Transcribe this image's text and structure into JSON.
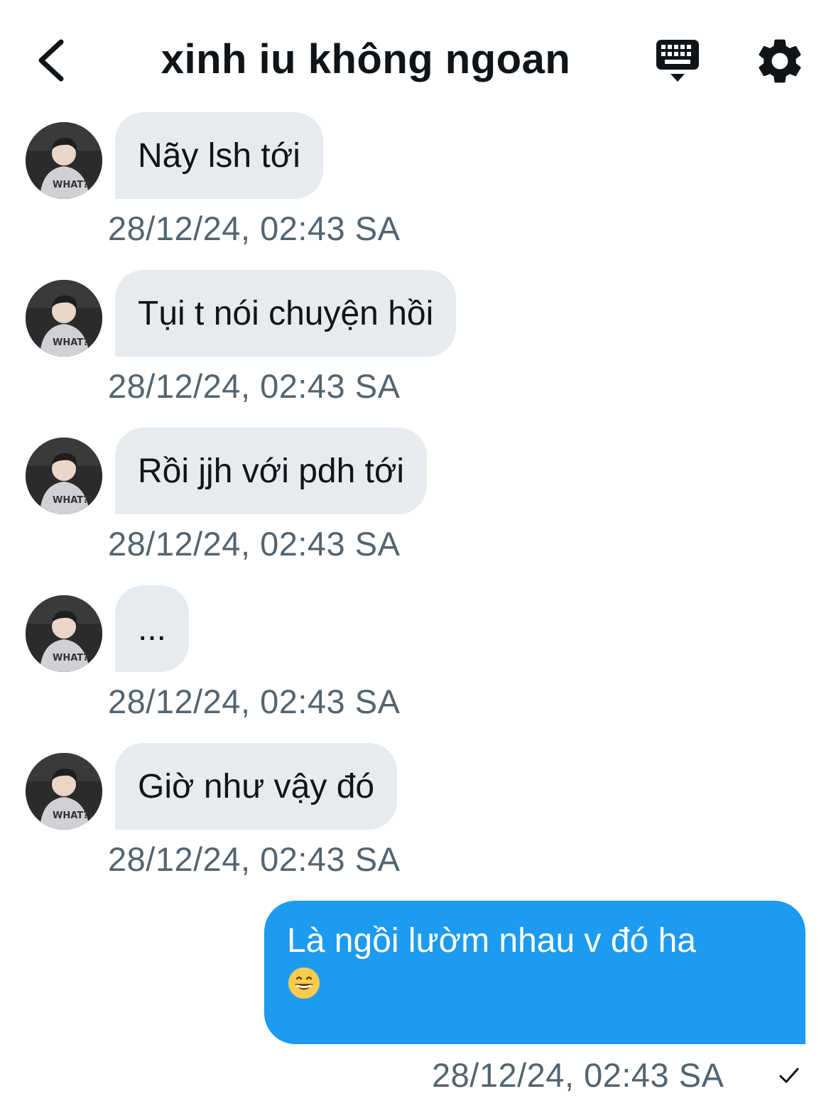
{
  "header": {
    "title": "xinh iu không ngoan",
    "back_icon": "chevron-left-icon",
    "keyboard_icon": "keyboard-icon",
    "settings_icon": "gear-icon"
  },
  "messages": [
    {
      "text": "Nãy lsh tới",
      "time": "28/12/24, 02:43 SA",
      "direction": "in"
    },
    {
      "text": "Tụi t nói chuyện hồi",
      "time": "28/12/24, 02:43 SA",
      "direction": "in"
    },
    {
      "text": "Rồi jjh với pdh tới",
      "time": "28/12/24, 02:43 SA",
      "direction": "in"
    },
    {
      "text": "...",
      "time": "28/12/24, 02:43 SA",
      "direction": "in"
    },
    {
      "text": "Giờ như vậy đó",
      "time": "28/12/24, 02:43 SA",
      "direction": "in"
    },
    {
      "text": "Là ngồi lườm nhau v đó ha",
      "time": "28/12/24, 02:43 SA",
      "direction": "out",
      "emoji": "grinning-face-icon",
      "status_icon": "check-icon"
    }
  ],
  "colors": {
    "incoming_bubble": "#e7ebef",
    "outgoing_bubble": "#1d9bf0",
    "timestamp": "#536471",
    "text": "#0f1419"
  }
}
